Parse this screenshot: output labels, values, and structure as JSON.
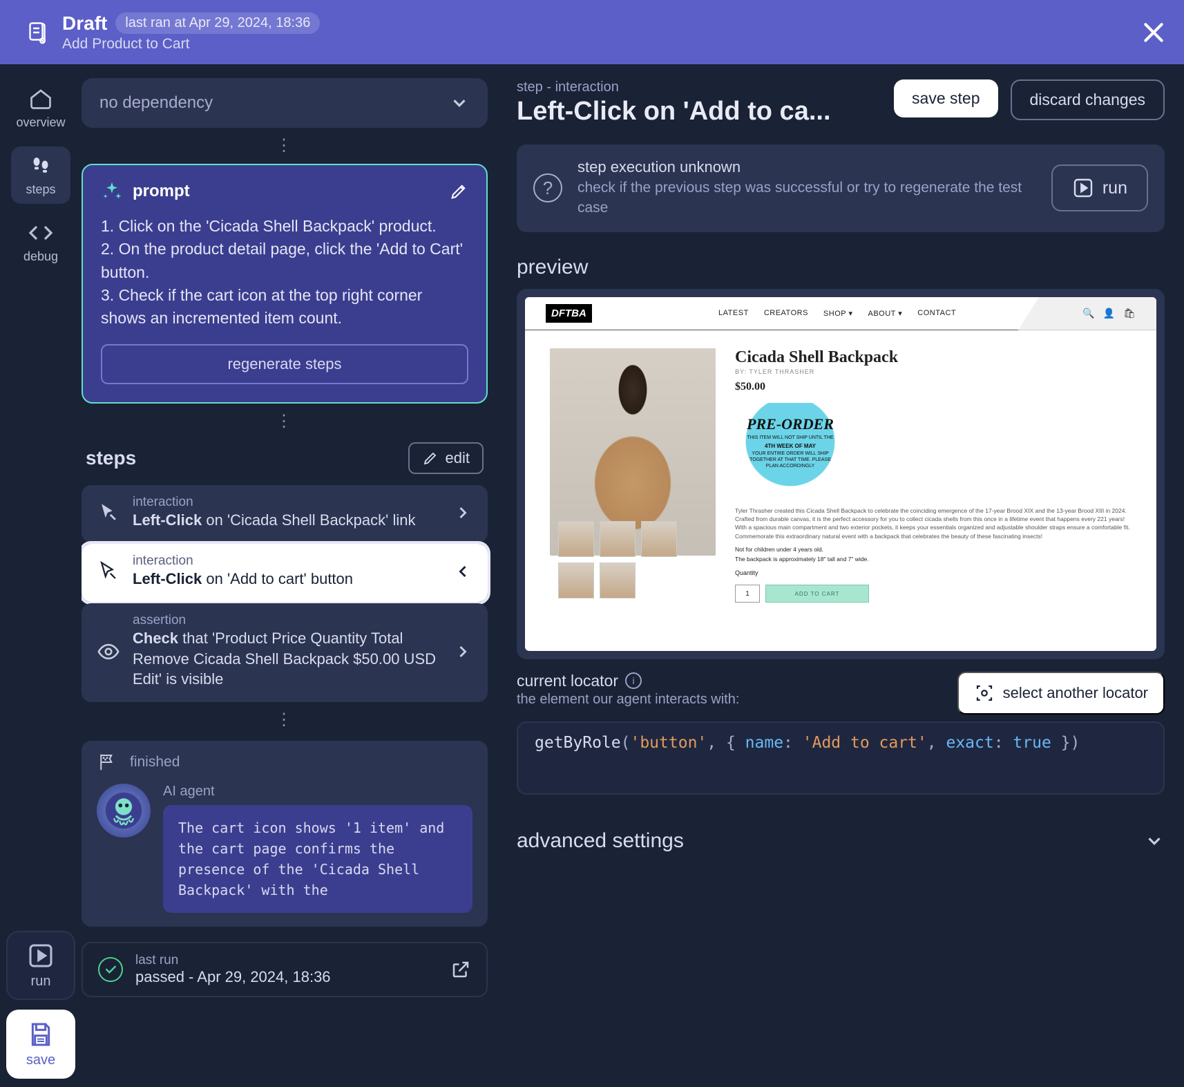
{
  "header": {
    "title": "Draft",
    "badge": "last ran at Apr 29, 2024, 18:36",
    "subtitle": "Add Product to Cart"
  },
  "rail": {
    "overview": "overview",
    "steps": "steps",
    "debug": "debug",
    "run": "run",
    "save": "save"
  },
  "middle": {
    "dependency": "no dependency",
    "prompt": {
      "title": "prompt",
      "text": "1. Click on the 'Cicada Shell Backpack' product.\n2. On the product detail page, click the 'Add to Cart' button.\n3. Check if the cart icon at the top right corner shows an incremented item count.",
      "regenerate": "regenerate steps"
    },
    "steps_title": "steps",
    "edit": "edit",
    "items": [
      {
        "kind": "interaction",
        "strong": "Left-Click",
        "rest": " on 'Cicada Shell Backpack' link"
      },
      {
        "kind": "interaction",
        "strong": "Left-Click",
        "rest": " on 'Add to cart' button"
      },
      {
        "kind": "assertion",
        "strong": "Check",
        "rest": " that 'Product Price Quantity Total Remove Cicada Shell Backpack $50.00 USD Edit' is visible"
      }
    ],
    "finished": "finished",
    "agent_label": "AI agent",
    "agent_msg": "The cart icon shows '1 item' and the cart page confirms the presence of the 'Cicada Shell Backpack' with the",
    "lastrun_label": "last run",
    "lastrun_text": "passed - Apr 29, 2024, 18:36"
  },
  "right": {
    "crumb": "step - interaction",
    "title": "Left-Click on 'Add to ca...",
    "save": "save step",
    "discard": "discard changes",
    "exec_title": "step execution unknown",
    "exec_sub": "check if the previous step was successful or try to regenerate the test case",
    "run": "run",
    "preview_title": "preview",
    "site": {
      "logo": "DFTBA",
      "nav": [
        "LATEST",
        "CREATORS",
        "SHOP ▾",
        "ABOUT ▾",
        "CONTACT"
      ],
      "product": "Cicada Shell Backpack",
      "byline": "BY: TYLER THRASHER",
      "price": "$50.00",
      "preorder_big": "PRE-ORDER",
      "preorder_l1": "THIS ITEM WILL NOT SHIP UNTIL THE",
      "preorder_l2": "4TH WEEK OF MAY",
      "preorder_l3": "YOUR ENTIRE ORDER WILL SHIP TOGETHER AT THAT TIME. PLEASE PLAN ACCORDINGLY",
      "qty_label": "Quantity",
      "qty": "1",
      "addcart": "ADD TO CART"
    },
    "locator_title": "current locator",
    "locator_sub": "the element our agent interacts with:",
    "select_another": "select another locator",
    "code": {
      "fn": "getByRole",
      "arg1": "'button'",
      "k": "name",
      "v": "'Add to cart'",
      "k2": "exact",
      "v2": "true"
    },
    "advset": "advanced settings"
  }
}
